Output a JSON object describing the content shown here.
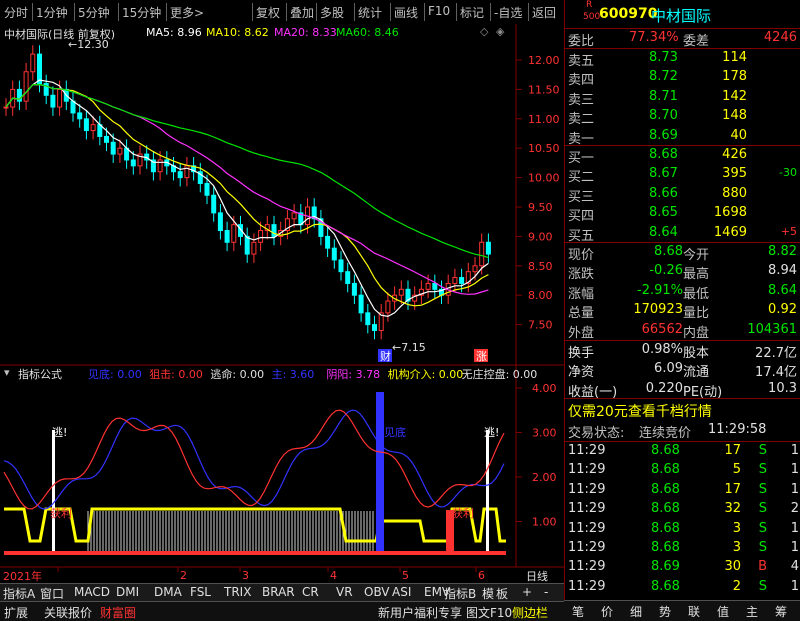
{
  "toolbar": {
    "items": [
      "分时",
      "1分钟",
      "5分钟",
      "15分钟",
      "更多>",
      "复权",
      "叠加",
      "多股",
      "统计",
      "画线",
      "F10",
      "标记",
      "-自选",
      "返回"
    ]
  },
  "chart_title": {
    "name": "中材国际(日线 前复权)",
    "ma5": "MA5: 8.96",
    "ma10": "MA10: 8.62",
    "ma20": "MA20: 8.33",
    "ma60": "MA60: 8.46"
  },
  "price_axis": [
    "12.00",
    "11.50",
    "11.00",
    "10.50",
    "10.00",
    "9.50",
    "9.00",
    "8.50",
    "8.00",
    "7.50"
  ],
  "price_marks": {
    "high": "12.30",
    "low": "7.15",
    "cai": "财",
    "zhang": "涨"
  },
  "indicator_bar": {
    "title": "指标公式",
    "items": [
      {
        "text": "见底: 0.00",
        "color": "#3232ff"
      },
      {
        "text": "狙击: 0.00",
        "color": "#ff3232"
      },
      {
        "text": "逃命: 0.00",
        "color": "#e0e0e0"
      },
      {
        "text": "主: 3.60",
        "color": "#3232ff"
      },
      {
        "text": "阴阳: 3.78",
        "color": "#ff32ff"
      },
      {
        "text": "机构介入: 0.00",
        "color": "#ffff00"
      },
      {
        "text": "无庄控盘: 0.00",
        "color": "#e0e0e0"
      }
    ]
  },
  "indicator_axis": [
    "4.00",
    "3.00",
    "2.00",
    "1.00"
  ],
  "indicator_marks": {
    "tao1": "逃!",
    "tao2": "逃!",
    "jiandi": "见底",
    "huoli1": "获利",
    "huoli2": "获利"
  },
  "time_axis": {
    "year": "2021年",
    "months": [
      "2",
      "3",
      "4",
      "5",
      "6"
    ],
    "period": "日线"
  },
  "stock": {
    "code": "600970",
    "name": "中材国际",
    "r_badge": "R",
    "num_badge": "500"
  },
  "weibi": {
    "label": "委比",
    "value": "77.34%",
    "label2": "委差",
    "value2": "4246"
  },
  "sells": [
    {
      "label": "卖五",
      "price": "8.73",
      "vol": "114"
    },
    {
      "label": "卖四",
      "price": "8.72",
      "vol": "178"
    },
    {
      "label": "卖三",
      "price": "8.71",
      "vol": "142"
    },
    {
      "label": "卖二",
      "price": "8.70",
      "vol": "148"
    },
    {
      "label": "卖一",
      "price": "8.69",
      "vol": "40"
    }
  ],
  "buys": [
    {
      "label": "买一",
      "price": "8.68",
      "vol": "426",
      "chg": ""
    },
    {
      "label": "买二",
      "price": "8.67",
      "vol": "395",
      "chg": "-30"
    },
    {
      "label": "买三",
      "price": "8.66",
      "vol": "880",
      "chg": ""
    },
    {
      "label": "买四",
      "price": "8.65",
      "vol": "1698",
      "chg": ""
    },
    {
      "label": "买五",
      "price": "8.64",
      "vol": "1469",
      "chg": "+5"
    }
  ],
  "quote": [
    {
      "l1": "现价",
      "v1": "8.68",
      "c1": "green",
      "l2": "今开",
      "v2": "8.82",
      "c2": "green"
    },
    {
      "l1": "涨跌",
      "v1": "-0.26",
      "c1": "green",
      "l2": "最高",
      "v2": "8.94",
      "c2": "white"
    },
    {
      "l1": "涨幅",
      "v1": "-2.91%",
      "c1": "green",
      "l2": "最低",
      "v2": "8.64",
      "c2": "green"
    },
    {
      "l1": "总量",
      "v1": "170923",
      "c1": "yellow",
      "l2": "量比",
      "v2": "0.92",
      "c2": "yellow"
    },
    {
      "l1": "外盘",
      "v1": "66562",
      "c1": "red",
      "l2": "内盘",
      "v2": "104361",
      "c2": "green"
    }
  ],
  "stats": [
    {
      "l1": "换手",
      "v1": "0.98%",
      "l2": "股本",
      "v2": "22.7亿"
    },
    {
      "l1": "净资",
      "v1": "6.09",
      "l2": "流通",
      "v2": "17.4亿"
    },
    {
      "l1": "收益(一)",
      "v1": "0.220",
      "l2": "PE(动)",
      "v2": "10.3"
    }
  ],
  "promo": "仅需20元查看千档行情",
  "trade_status": {
    "label": "交易状态:",
    "value": "连续竞价",
    "time": "11:29:58"
  },
  "trades": [
    {
      "time": "11:29",
      "price": "8.68",
      "vol": "17",
      "side": "S",
      "n": "1"
    },
    {
      "time": "11:29",
      "price": "8.68",
      "vol": "5",
      "side": "S",
      "n": "1"
    },
    {
      "time": "11:29",
      "price": "8.68",
      "vol": "17",
      "side": "S",
      "n": "1"
    },
    {
      "time": "11:29",
      "price": "8.68",
      "vol": "32",
      "side": "S",
      "n": "2"
    },
    {
      "time": "11:29",
      "price": "8.68",
      "vol": "3",
      "side": "S",
      "n": "1"
    },
    {
      "time": "11:29",
      "price": "8.68",
      "vol": "3",
      "side": "S",
      "n": "1"
    },
    {
      "time": "11:29",
      "price": "8.69",
      "vol": "30",
      "side": "B",
      "n": "4"
    },
    {
      "time": "11:29",
      "price": "8.68",
      "vol": "2",
      "side": "S",
      "n": "1"
    }
  ],
  "tabs1": [
    "指标A",
    "窗口",
    "MACD",
    "DMI",
    "DMA",
    "FSL",
    "TRIX",
    "BRAR",
    "CR",
    "VR",
    "OBV",
    "ASI",
    "EMV",
    "指标B",
    "模",
    "板",
    "+",
    "-"
  ],
  "tabs2": [
    "扩展",
    "关联报价",
    "财富圈",
    "新用户福利专享",
    "图文F10",
    "侧边栏"
  ],
  "rtabs": [
    "笔",
    "价",
    "细",
    "势",
    "联",
    "值",
    "主",
    "筹"
  ],
  "colors": {
    "up": "#ff3232",
    "down": "#00ffff",
    "ma5": "#ffffff",
    "ma10": "#ffff00",
    "ma20": "#ff32ff",
    "ma60": "#00e600",
    "frame": "#800000"
  }
}
